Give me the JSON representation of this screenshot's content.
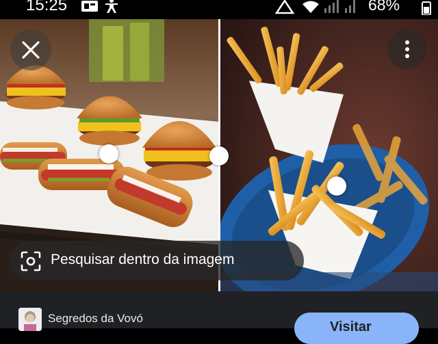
{
  "status_bar": {
    "time": "15:25",
    "battery": "68%"
  },
  "search": {
    "label": "Pesquisar dentro da imagem"
  },
  "result": {
    "source_name": "Segredos da Vovó",
    "visit_label": "Visitar"
  },
  "colors": {
    "sheet_bg": "#202124",
    "visit_button": "#8ab4f8"
  }
}
